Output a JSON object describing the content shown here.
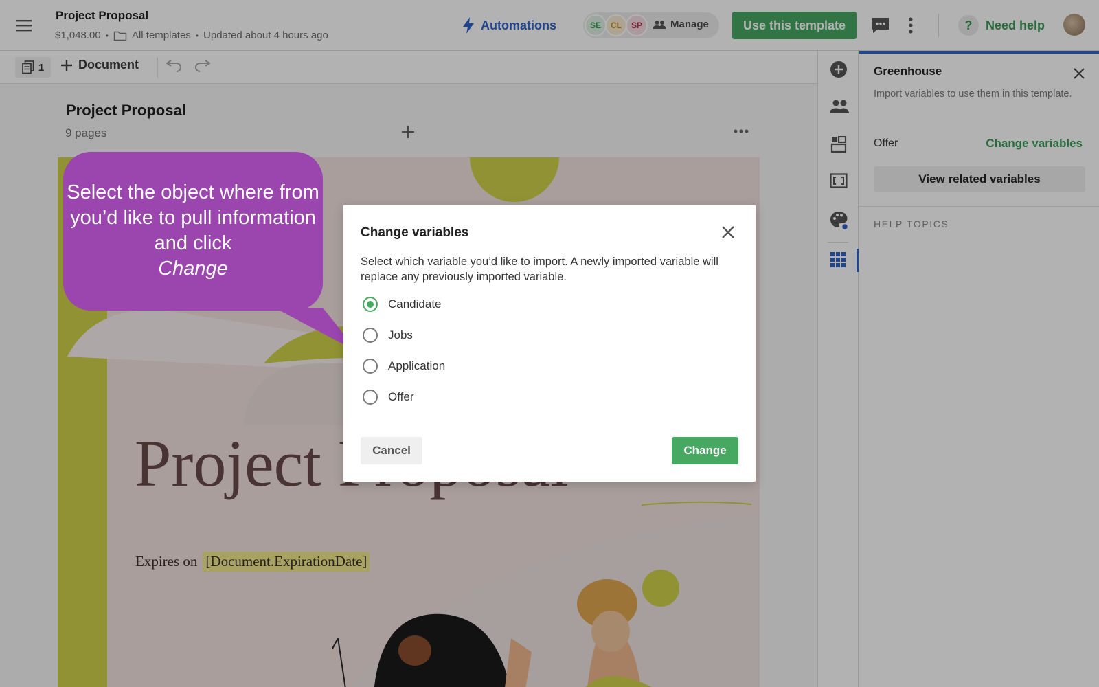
{
  "header": {
    "doc_title": "Project Proposal",
    "price": "$1,048.00",
    "folder": "All templates",
    "updated": "Updated about 4 hours ago",
    "automations": "Automations",
    "avatars": [
      {
        "initials": "SE",
        "color": "#3a9a57",
        "bg": "#dff0e3"
      },
      {
        "initials": "CL",
        "color": "#c98a1f",
        "bg": "#f6ead3"
      },
      {
        "initials": "SP",
        "color": "#b5314f",
        "bg": "#f4dbe1"
      }
    ],
    "manage": "Manage",
    "use_template": "Use this template",
    "need_help": "Need help",
    "help_glyph": "?"
  },
  "toolbar": {
    "page_count": "1",
    "add_document": "Document"
  },
  "canvas": {
    "title": "Project Proposal",
    "pages": "9 pages",
    "page_title": "Project Proposal",
    "expires_label": "Expires on",
    "expires_var": "[Document.ExpirationDate]"
  },
  "panel": {
    "title": "Greenhouse",
    "description": "Import variables to use them in this template.",
    "object_label": "Offer",
    "change_variables": "Change variables",
    "view_related": "View related variables",
    "help_topics": "HELP TOPICS"
  },
  "callout": {
    "text": "Select the object where from you’d like to pull information and click",
    "emphasis": "Change"
  },
  "modal": {
    "title": "Change variables",
    "description": "Select which variable you’d like to import. A newly imported variable will replace any previously imported variable.",
    "options": [
      "Candidate",
      "Jobs",
      "Application",
      "Offer"
    ],
    "selected": "Candidate",
    "cancel": "Cancel",
    "change": "Change"
  },
  "colors": {
    "brand_green": "#47a862",
    "link_blue": "#2f63c9",
    "callout_purple": "#9b45af",
    "page_accent": "#cfd24a"
  }
}
